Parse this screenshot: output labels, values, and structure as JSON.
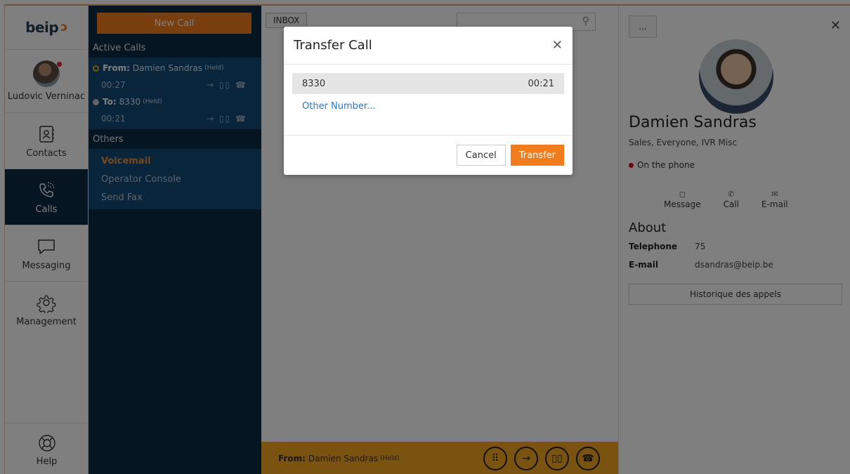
{
  "brand": {
    "logo_text": "beip",
    "accent": "#f07c1b",
    "navy": "#0d2b44"
  },
  "nav": {
    "user_name": "Ludovic Verninac",
    "contacts": "Contacts",
    "calls": "Calls",
    "messaging": "Messaging",
    "management": "Management",
    "help": "Help"
  },
  "calls_panel": {
    "new_call": "New Call",
    "active_header": "Active Calls",
    "calls": [
      {
        "direction": "From:",
        "party": "Damien Sandras",
        "state": "(Held)",
        "duration": "00:27",
        "actions": "→ ▯▯ ☎"
      },
      {
        "direction": "To:",
        "party": "8330",
        "state": "(Held)",
        "duration": "00:21",
        "actions": "→ ▯▯ ☎"
      }
    ],
    "others_header": "Others",
    "others": [
      "Voicemail",
      "Operator Console",
      "Send Fax"
    ]
  },
  "middle": {
    "inbox_tab": "INBOX",
    "search_placeholder": "",
    "bottombar": {
      "direction": "From:",
      "party": "Damien Sandras",
      "state": "(Held)"
    }
  },
  "contact": {
    "more": "...",
    "name": "Damien Sandras",
    "groups": "Sales, Everyone, IVR Misc",
    "status": "On the phone",
    "actions": {
      "message": "Message",
      "call": "Call",
      "email": "E-mail"
    },
    "about": "About",
    "telephone_label": "Telephone",
    "telephone": "75",
    "email_label": "E-mail",
    "email": "dsandras@beip.be",
    "history_button": "Historique des appels"
  },
  "modal": {
    "title": "Transfer Call",
    "call_number": "8330",
    "call_time": "00:21",
    "other_number": "Other Number...",
    "cancel": "Cancel",
    "transfer": "Transfer"
  }
}
